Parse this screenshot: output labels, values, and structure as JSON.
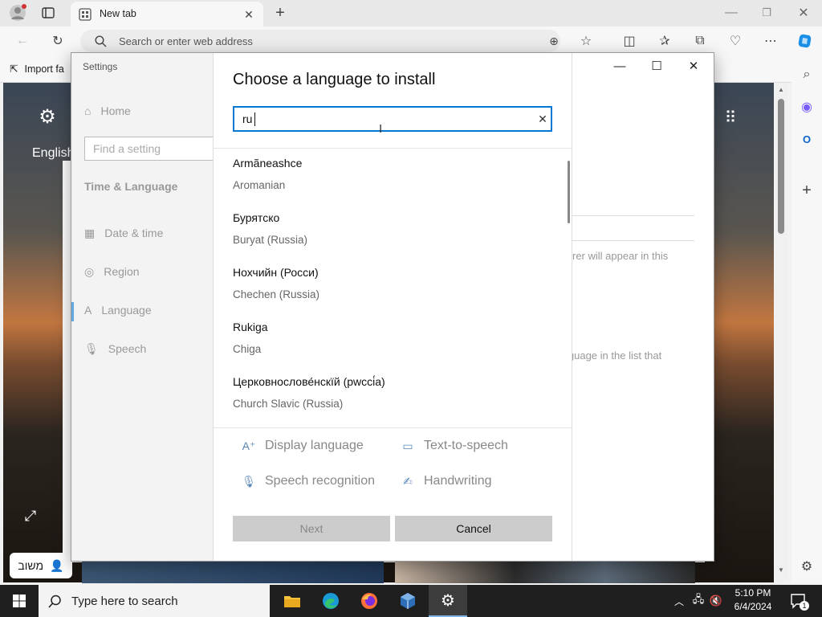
{
  "browser": {
    "tab_title": "New tab",
    "address_placeholder": "Search or enter web address",
    "favorites_item": "Import fa"
  },
  "ntp": {
    "language_label": "English",
    "hebrew_button": "משוב"
  },
  "settings": {
    "window_title": "Settings",
    "home_label": "Home",
    "find_placeholder": "Find a setting",
    "section": "Time & Language",
    "nav": [
      {
        "label": "Date & time",
        "icon": "calendar-clock-icon"
      },
      {
        "label": "Region",
        "icon": "globe-icon"
      },
      {
        "label": "Language",
        "icon": "language-icon"
      },
      {
        "label": "Speech",
        "icon": "microphone-icon"
      }
    ],
    "bg_text_1": "rer will appear in this",
    "bg_text_2": "iguage in the list that"
  },
  "dialog": {
    "title": "Choose a language to install",
    "search_value": "ru",
    "languages": [
      {
        "native": "Armãneashce",
        "english": "Aromanian"
      },
      {
        "native": "Бурятско",
        "english": "Buryat (Russia)"
      },
      {
        "native": "Нохчийн (Росси)",
        "english": "Chechen (Russia)"
      },
      {
        "native": "Rukiga",
        "english": "Chiga"
      },
      {
        "native": "Церковнослове́нскїй (рwссі́а)",
        "english": "Church Slavic (Russia)"
      }
    ],
    "features": {
      "display_language": "Display language",
      "text_to_speech": "Text-to-speech",
      "speech_recognition": "Speech recognition",
      "handwriting": "Handwriting"
    },
    "next_label": "Next",
    "cancel_label": "Cancel"
  },
  "taskbar": {
    "search_placeholder": "Type here to search",
    "time": "5:10 PM",
    "date": "6/4/2024",
    "notification_count": "1"
  },
  "colors": {
    "accent": "#0078d4",
    "taskbar": "#1f1f1f",
    "button_disabled": "#cccccc"
  }
}
